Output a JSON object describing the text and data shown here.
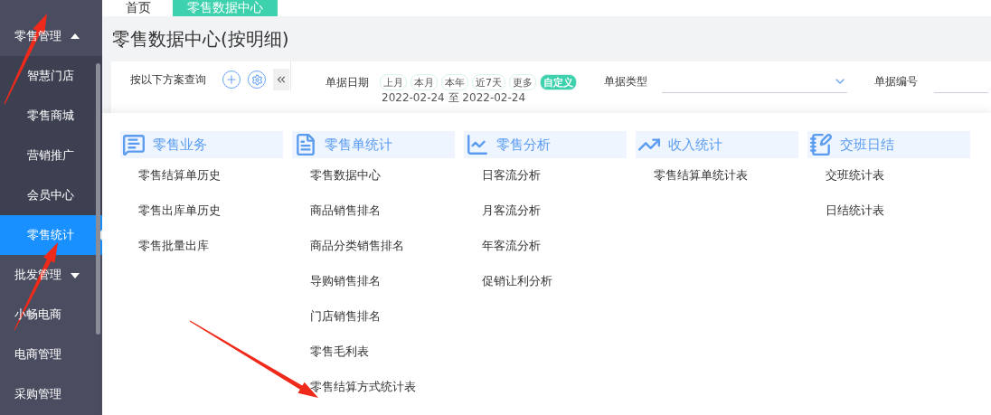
{
  "tabs": [
    {
      "label": "首页",
      "selected": false
    },
    {
      "label": "零售数据中心",
      "selected": true
    }
  ],
  "sidebar": {
    "items": [
      {
        "label": "零售管理",
        "kind": "group",
        "expanded": true,
        "children": [
          {
            "label": "智慧门店",
            "selected": false
          },
          {
            "label": "零售商城",
            "selected": false
          },
          {
            "label": "营销推广",
            "selected": false
          },
          {
            "label": "会员中心",
            "selected": false
          },
          {
            "label": "零售统计",
            "selected": true
          }
        ]
      },
      {
        "label": "批发管理",
        "kind": "group",
        "expanded": false
      },
      {
        "label": "小畅电商",
        "kind": "link"
      },
      {
        "label": "电商管理",
        "kind": "link"
      },
      {
        "label": "采购管理",
        "kind": "link"
      }
    ]
  },
  "page_title": "零售数据中心(按明细)",
  "scheme_panel": {
    "title": "按以下方案查询"
  },
  "filters": {
    "date_label": "单据日期",
    "quick_dates": [
      {
        "label": "上月",
        "selected": false
      },
      {
        "label": "本月",
        "selected": false
      },
      {
        "label": "本年",
        "selected": false
      },
      {
        "label": "近7天",
        "selected": false
      },
      {
        "label": "更多",
        "selected": false
      },
      {
        "label": "自定义",
        "selected": true
      }
    ],
    "date_range": "2022-02-24 至 2022-02-24",
    "type_label": "单据类型",
    "number_label": "单据编号"
  },
  "menu": {
    "columns": [
      {
        "title": "零售业务",
        "items": [
          "零售结算单历史",
          "零售出库单历史",
          "零售批量出库"
        ]
      },
      {
        "title": "零售单统计",
        "items": [
          "零售数据中心",
          "商品销售排名",
          "商品分类销售排名",
          "导购销售排名",
          "门店销售排名",
          "零售毛利表",
          "零售结算方式统计表"
        ]
      },
      {
        "title": "零售分析",
        "items": [
          "日客流分析",
          "月客流分析",
          "年客流分析",
          "促销让利分析"
        ]
      },
      {
        "title": "收入统计",
        "items": [
          "零售结算单统计表"
        ]
      },
      {
        "title": "交班日结",
        "items": [
          "交班统计表",
          "日结统计表"
        ]
      }
    ]
  }
}
